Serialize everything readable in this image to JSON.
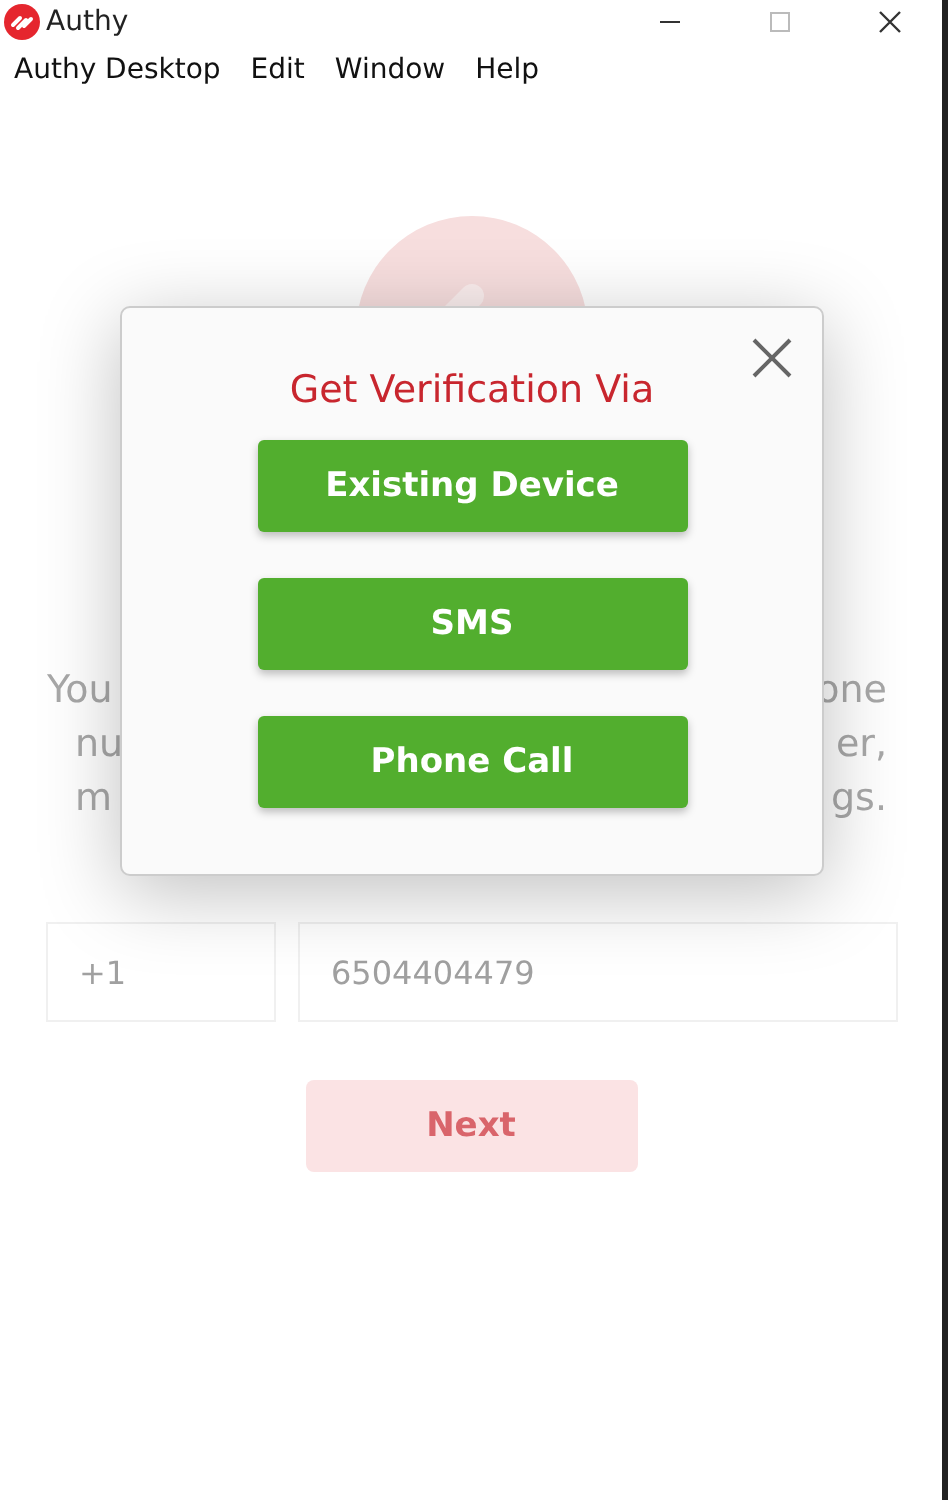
{
  "window": {
    "title": "Authy"
  },
  "menu": [
    "Authy Desktop",
    "Edit",
    "Window",
    "Help"
  ],
  "intro_lines": [
    {
      "left": "You",
      "right": "one"
    },
    {
      "left": "nu",
      "right": "er,"
    },
    {
      "left": "m",
      "right": "gs."
    }
  ],
  "country_code": {
    "value": "+1"
  },
  "phone_number": {
    "value": "6504404479"
  },
  "next_button": {
    "label": "Next",
    "disabled": true
  },
  "dialog": {
    "title": "Get Verification Via",
    "options": [
      "Existing Device",
      "SMS",
      "Phone Call"
    ]
  }
}
